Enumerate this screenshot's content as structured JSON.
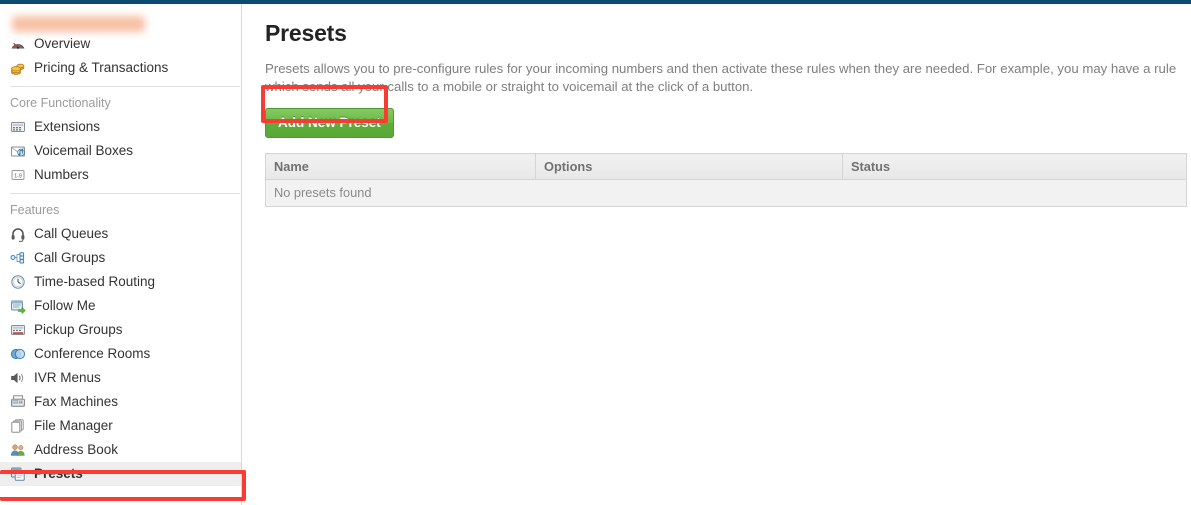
{
  "theme": {
    "topbar_color": "#0d4a72",
    "accent_green": "#5dae39",
    "annotation_red": "#f93c33",
    "sidebar_border": "#d8d8d8"
  },
  "sidebar": {
    "brand_redacted": "",
    "top_items": [
      {
        "label": "Overview",
        "icon": "speedometer-icon"
      },
      {
        "label": "Pricing & Transactions",
        "icon": "coins-icon"
      }
    ],
    "sections": [
      {
        "heading": "Core Functionality",
        "items": [
          {
            "label": "Extensions",
            "icon": "keypad-icon"
          },
          {
            "label": "Voicemail Boxes",
            "icon": "voicemail-envelope-icon"
          },
          {
            "label": "Numbers",
            "icon": "number-pad-icon"
          }
        ]
      },
      {
        "heading": "Features",
        "items": [
          {
            "label": "Call Queues",
            "icon": "headset-icon"
          },
          {
            "label": "Call Groups",
            "icon": "network-tree-icon"
          },
          {
            "label": "Time-based Routing",
            "icon": "clock-icon"
          },
          {
            "label": "Follow Me",
            "icon": "window-forward-icon"
          },
          {
            "label": "Pickup Groups",
            "icon": "desk-phone-icon"
          },
          {
            "label": "Conference Rooms",
            "icon": "conference-circles-icon"
          },
          {
            "label": "IVR Menus",
            "icon": "speaker-icon"
          },
          {
            "label": "Fax Machines",
            "icon": "fax-icon"
          },
          {
            "label": "File Manager",
            "icon": "documents-stack-icon"
          },
          {
            "label": "Address Book",
            "icon": "people-icon"
          },
          {
            "label": "Presets",
            "icon": "presets-window-icon",
            "active": true
          }
        ]
      }
    ]
  },
  "main": {
    "title": "Presets",
    "description": "Presets allows you to pre-configure rules for your incoming numbers and then activate these rules when they are needed. For example, you may have a rule which sends all your calls to a mobile or straight to voicemail at the click of a button.",
    "add_button_label": "Add New Preset",
    "table": {
      "columns": [
        "Name",
        "Options",
        "Status"
      ],
      "rows": [],
      "empty_message": "No presets found"
    }
  }
}
